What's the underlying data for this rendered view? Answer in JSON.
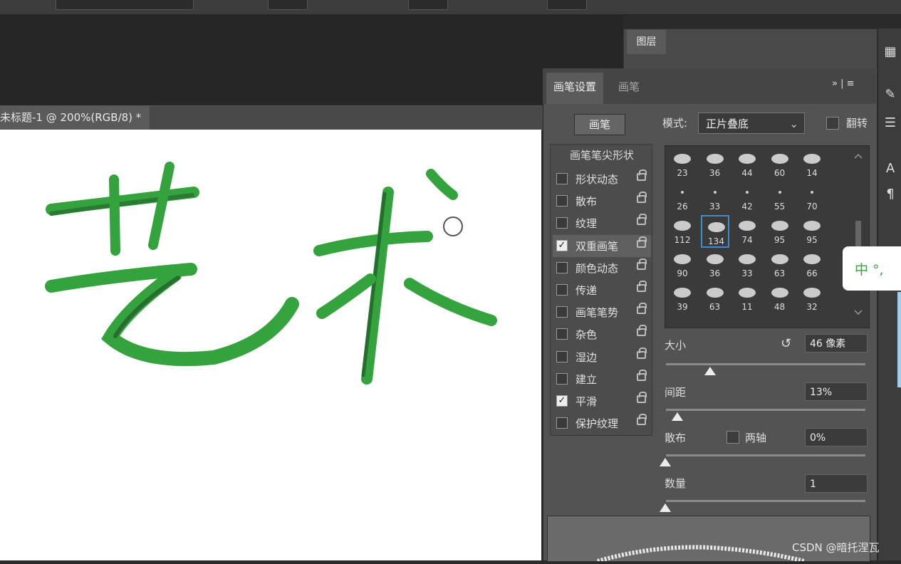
{
  "document": {
    "tab_title": "未标题-1 @ 200%(RGB/8) *"
  },
  "layers_panel": {
    "tab_label": "图层"
  },
  "brush_panel": {
    "tabs": [
      "画笔设置",
      "画笔"
    ],
    "brush_button": "画笔",
    "mode_label": "模式:",
    "mode_value": "正片叠底",
    "flip_label": "翻转",
    "tip_shape_label": "画笔笔尖形状",
    "options": [
      {
        "label": "形状动态",
        "checked": false
      },
      {
        "label": "散布",
        "checked": false
      },
      {
        "label": "纹理",
        "checked": false
      },
      {
        "label": "双重画笔",
        "checked": true
      },
      {
        "label": "颜色动态",
        "checked": false
      },
      {
        "label": "传递",
        "checked": false
      },
      {
        "label": "画笔笔势",
        "checked": false
      },
      {
        "label": "杂色",
        "checked": false
      },
      {
        "label": "湿边",
        "checked": false
      },
      {
        "label": "建立",
        "checked": false
      },
      {
        "label": "平滑",
        "checked": true
      },
      {
        "label": "保护纹理",
        "checked": false
      }
    ],
    "presets": [
      [
        "23",
        "36",
        "44",
        "60",
        "14"
      ],
      [
        "26",
        "33",
        "42",
        "55",
        "70"
      ],
      [
        "112",
        "134",
        "74",
        "95",
        "95"
      ],
      [
        "90",
        "36",
        "33",
        "63",
        "66"
      ],
      [
        "39",
        "63",
        "11",
        "48",
        "32"
      ]
    ],
    "size_label": "大小",
    "size_value": "46 像素",
    "spacing_label": "间距",
    "spacing_value": "13%",
    "scatter_label": "散布",
    "both_axes_label": "两轴",
    "scatter_value": "0%",
    "count_label": "数量",
    "count_value": "1"
  },
  "canvas_text": "艺术",
  "ime": {
    "text": "中 °,"
  },
  "watermark": "CSDN @暗托涅瓦",
  "colors": {
    "stroke": "#1f9a2a",
    "panel": "#535353",
    "selection": "#3e8bd0"
  }
}
